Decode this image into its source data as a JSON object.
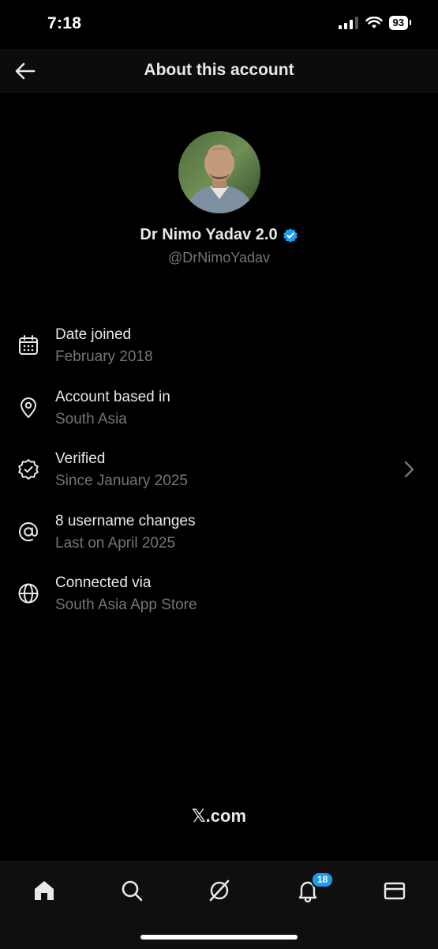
{
  "status": {
    "time": "7:18",
    "battery": "93"
  },
  "header": {
    "title": "About this account"
  },
  "profile": {
    "name": "Dr Nimo Yadav 2.0",
    "handle": "@DrNimoYadav",
    "verified_color": "#1d9bf0"
  },
  "info_items": [
    {
      "icon": "calendar-icon",
      "title": "Date joined",
      "subtitle": "February 2018"
    },
    {
      "icon": "location-pin-icon",
      "title": "Account based in",
      "subtitle": "South Asia"
    },
    {
      "icon": "verified-badge-icon",
      "title": "Verified",
      "subtitle": "Since January 2025"
    },
    {
      "icon": "at-sign-icon",
      "title": "8 username changes",
      "subtitle": "Last on April 2025"
    },
    {
      "icon": "globe-icon",
      "title": "Connected via",
      "subtitle": "South Asia App Store"
    }
  ],
  "footer": {
    "brand": "𝕏.com"
  },
  "tabs": [
    {
      "icon": "home-icon"
    },
    {
      "icon": "search-icon"
    },
    {
      "icon": "grok-icon"
    },
    {
      "icon": "bell-icon",
      "badge": "18"
    },
    {
      "icon": "mail-icon"
    }
  ],
  "colors": {
    "background": "#000000",
    "text_primary": "#e7e9ea",
    "text_secondary": "#71767b",
    "accent": "#1d9bf0"
  }
}
